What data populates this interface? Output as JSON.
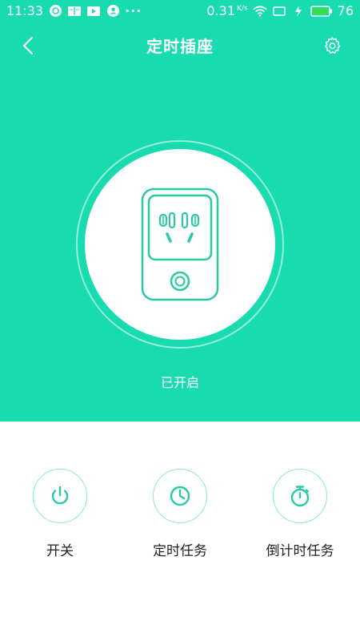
{
  "statusbar": {
    "time": "11:33",
    "more": "···",
    "net_speed": "0.31",
    "net_unit": "K/s",
    "battery": "76"
  },
  "header": {
    "title": "定时插座"
  },
  "device": {
    "status": "已开启"
  },
  "actions": [
    {
      "label": "开关",
      "icon": "power-icon"
    },
    {
      "label": "定时任务",
      "icon": "clock-icon"
    },
    {
      "label": "倒计时任务",
      "icon": "stopwatch-icon"
    }
  ],
  "colors": {
    "accent": "#18dcb0",
    "icon_stroke": "#29c9a3",
    "ring": "#88e9d3"
  }
}
